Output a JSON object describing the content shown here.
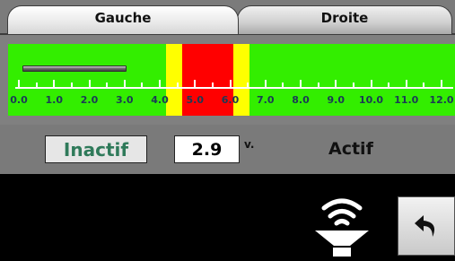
{
  "tabs": {
    "left": {
      "label": "Gauche"
    },
    "right": {
      "label": "Droite"
    }
  },
  "gauge": {
    "min": 0.0,
    "max": 12.0,
    "ticks": [
      "0.0",
      "1.0",
      "2.0",
      "3.0",
      "4.0",
      "5.0",
      "6.0",
      "7.0",
      "8.0",
      "9.0",
      "10.0",
      "11.0",
      "12.0"
    ],
    "indicator_range": [
      0.0,
      3.0
    ],
    "zones": {
      "yellow": [
        4.0,
        4.5
      ],
      "red": [
        4.5,
        5.5
      ],
      "yellow_high": [
        5.5,
        6.0
      ]
    },
    "colors": {
      "scale": "#33ee00",
      "red": "#ff0000",
      "yellow": "#ffff00"
    }
  },
  "status": {
    "inactive_label": "Inactif",
    "value": "2.9",
    "unit": "v.",
    "active_label": "Actif"
  },
  "icons": {
    "speaker": "speaker-wireless-icon",
    "back": "back-arrow-icon"
  }
}
